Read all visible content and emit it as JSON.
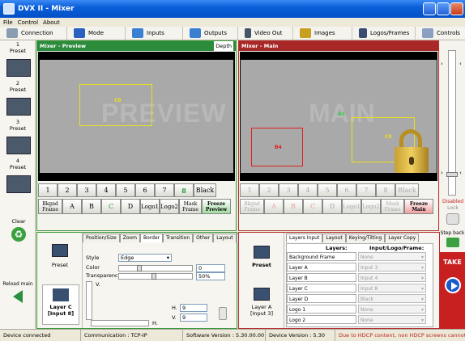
{
  "window": {
    "title": "DVX II - Mixer"
  },
  "menu": [
    "File",
    "Control",
    "About"
  ],
  "toolbar": [
    {
      "label": "Connection",
      "icon": "connection-icon"
    },
    {
      "label": "Mode",
      "icon": "mode-icon"
    },
    {
      "label": "Inputs",
      "icon": "inputs-icon"
    },
    {
      "label": "Outputs",
      "icon": "outputs-icon"
    },
    {
      "label": "Video Out",
      "icon": "video-out-icon"
    },
    {
      "label": "Images",
      "icon": "images-icon"
    },
    {
      "label": "Logos/Frames",
      "icon": "logos-frames-icon"
    },
    {
      "label": "Controls",
      "icon": "controls-icon"
    }
  ],
  "presets": [
    {
      "num": "1",
      "label": "Preset"
    },
    {
      "num": "2",
      "label": "Preset"
    },
    {
      "num": "3",
      "label": "Preset"
    },
    {
      "num": "4",
      "label": "Preset"
    }
  ],
  "left_bottom": {
    "clear": "Clear",
    "reload": "Reload main"
  },
  "preview": {
    "title": "Mixer - Preview",
    "depth": "Depth",
    "watermark": "PREVIEW",
    "layer_label": "C8",
    "buttons_row1": [
      "1",
      "2",
      "3",
      "4",
      "5",
      "6",
      "7",
      "8",
      "Black"
    ],
    "buttons_row2": [
      "Bkgnd Frame",
      "A",
      "B",
      "C",
      "D",
      "Logo1",
      "Logo2",
      "Mask Frame",
      "Freeze Preview"
    ]
  },
  "main": {
    "title": "Mixer - Main",
    "watermark": "MAIN",
    "labels": {
      "a3": "A3",
      "b4": "B4",
      "c8": "C8"
    },
    "buttons_row1": [
      "1",
      "2",
      "3",
      "4",
      "5",
      "6",
      "7",
      "8",
      "Black"
    ],
    "buttons_row2": [
      "Bkgnd Frame",
      "A",
      "B",
      "C",
      "D",
      "Logo1",
      "Logo2",
      "Mask Frame",
      "Freeze Main"
    ]
  },
  "right_side": {
    "disabled": "Disabled",
    "lock": "Lock",
    "step_back": "Step back",
    "take": "TAKE"
  },
  "preview_edit": {
    "tabs": [
      "Position/Size",
      "Zoom",
      "Border",
      "Transition",
      "Other",
      "Layout"
    ],
    "active_tab": "Border",
    "preset_label": "Preset",
    "layer_label": "Layer C [Input 8]",
    "style_label": "Style",
    "style_value": "Edge",
    "color_label": "Color",
    "color_value": "0",
    "transparency_label": "Transparency",
    "transparency_value": "50%",
    "v_label": "V.",
    "h_label": "H.",
    "h_value": "9",
    "v2_label": "V.",
    "v2_value": "9"
  },
  "main_edit": {
    "tabs": [
      "Layers Input",
      "Layout",
      "Keying/Tilting",
      "Layer Copy"
    ],
    "preset_label": "Preset",
    "layer_label": "Layer A [Input 3]",
    "col_layers": "Layers:",
    "col_input": "Input/Logo/Frame:",
    "rows": [
      {
        "name": "Background Frame",
        "value": "None"
      },
      {
        "name": "Layer A",
        "value": "Input 3"
      },
      {
        "name": "Layer B",
        "value": "Input 4"
      },
      {
        "name": "Layer C",
        "value": "Input 8"
      },
      {
        "name": "Layer D",
        "value": "Black"
      },
      {
        "name": "Logo 1",
        "value": "None"
      },
      {
        "name": "Logo 2",
        "value": "None"
      }
    ]
  },
  "status": {
    "device": "Device connected",
    "communication": "Communication : TCP-IP",
    "software": "Software Version : 5.30.00.00",
    "device_version": "Device Version : 5.30",
    "hdcp": "Due to HDCP content, non HDCP screens cannot display protected"
  }
}
